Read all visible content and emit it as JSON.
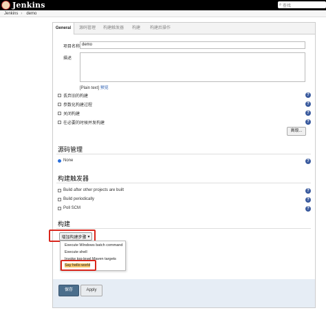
{
  "header": {
    "app_name": "Jenkins",
    "search_placeholder": "查找"
  },
  "breadcrumb": [
    "Jenkins",
    "demo"
  ],
  "tabs": [
    "General",
    "源码管理",
    "构建触发器",
    "构建",
    "构建后操作"
  ],
  "general": {
    "project_name_label": "项目名称",
    "project_name_value": "demo",
    "description_label": "描述",
    "plain_text": "[Plain text]",
    "preview_link": "预览",
    "options": [
      "丢弃旧的构建",
      "参数化构建过程",
      "关闭构建",
      "在必要的时候并发构建"
    ],
    "advanced_button": "高级..."
  },
  "scm": {
    "title": "源码管理",
    "option_none": "None"
  },
  "triggers": {
    "title": "构建触发器",
    "options": [
      "Build after other projects are built",
      "Build periodically",
      "Poll SCM"
    ]
  },
  "build": {
    "title": "构建",
    "add_step_button": "增加构建步骤",
    "dropdown_arrow": "▾",
    "menu_items": [
      "Execute Windows batch command",
      "Execute shell",
      "Invoke top-level Maven targets",
      "Say hello world"
    ]
  },
  "footer": {
    "save_button": "保存",
    "apply_button": "Apply"
  },
  "help_glyph": "?",
  "colors": {
    "header_bg": "#000000",
    "save_bg": "#4b6e8c",
    "highlight_box": "#d9261c",
    "menu_highlight": "#f7c56a"
  }
}
